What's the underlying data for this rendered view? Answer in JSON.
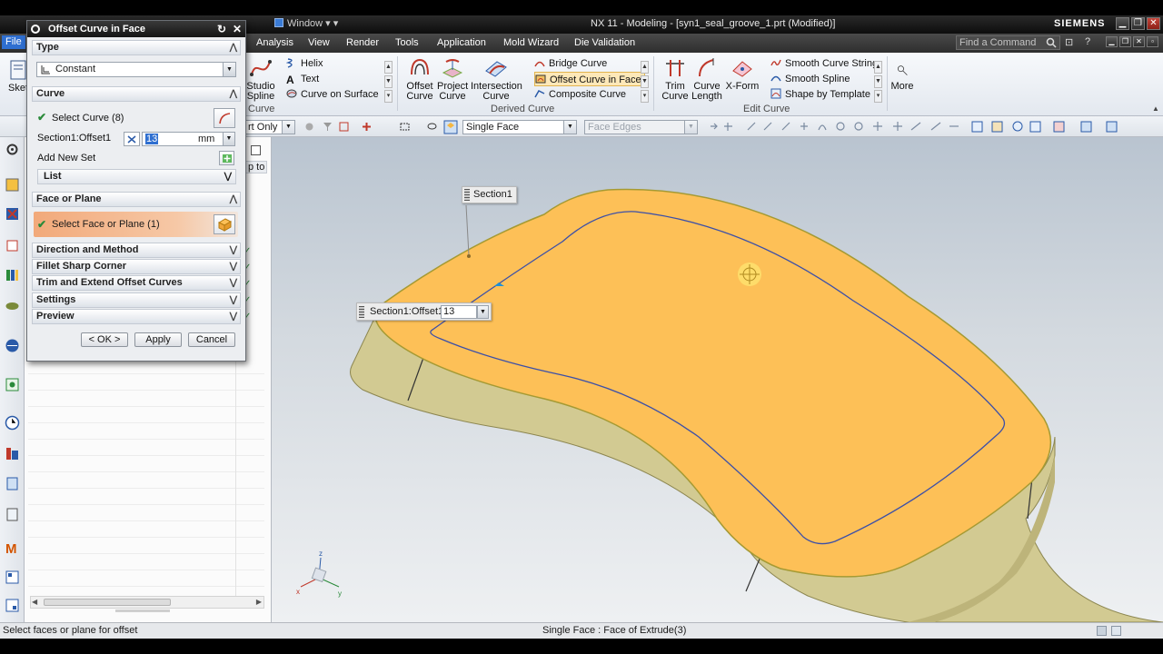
{
  "window": {
    "title": "NX 11 - Modeling - [syn1_seal_groove_1.prt (Modified)]",
    "brand": "SIEMENS",
    "window_menu": "Window"
  },
  "menubar": {
    "file_partial": "File",
    "items": [
      "Analysis",
      "View",
      "Render",
      "Tools",
      "Application",
      "Mold Wizard",
      "Die Validation"
    ],
    "search_placeholder": "Find a Command"
  },
  "ribbon": {
    "sketch_partial": "Sket",
    "studio_spline": [
      "Studio",
      "Spline"
    ],
    "curve_group_label": "Curve",
    "small_curve_items": [
      "Helix",
      "Text",
      "Curve on Surface"
    ],
    "offset_curve": [
      "Offset",
      "Curve"
    ],
    "project_curve": [
      "Project",
      "Curve"
    ],
    "intersection_curve": [
      "Intersection",
      "Curve"
    ],
    "derived_items": [
      "Bridge Curve",
      "Offset Curve in Face",
      "Composite Curve"
    ],
    "derived_group_label": "Derived Curve",
    "trim_curve": [
      "Trim",
      "Curve"
    ],
    "curve_length": [
      "Curve",
      "Length"
    ],
    "xform": "X-Form",
    "edit_items": [
      "Smooth Curve String",
      "Smooth Spline",
      "Shape by Template"
    ],
    "edit_group_label": "Edit Curve",
    "more": "More"
  },
  "selection_bar": {
    "filter_partial": "rt Only",
    "face_rule": "Single Face",
    "edge_rule": "Face Edges"
  },
  "navigator": {
    "snippet": "p to"
  },
  "dialog": {
    "title": "Offset Curve in Face",
    "type_section": "Type",
    "type_value": "Constant",
    "curve_section": "Curve",
    "select_curve": "Select Curve (8)",
    "offset_label": "Section1:Offset1",
    "offset_value": "13",
    "offset_unit": "mm",
    "add_new_set": "Add New Set",
    "list": "List",
    "face_section": "Face or Plane",
    "select_face": "Select Face or Plane (1)",
    "collapsed_sections": [
      "Direction and Method",
      "Fillet Sharp Corner",
      "Trim and Extend Offset Curves",
      "Settings",
      "Preview"
    ],
    "ok": "< OK >",
    "apply": "Apply",
    "cancel": "Cancel"
  },
  "viewport": {
    "section_tag": "Section1",
    "offset_tag": "Section1:Offset1",
    "offset_tag_value": "13"
  },
  "status": {
    "left": "Select faces or plane for offset",
    "center": "Single Face : Face of Extrude(3)"
  },
  "colors": {
    "face_orange": "#fdc057",
    "side_khaki": "#d2ca92",
    "curve_blue": "#3b4fa8",
    "selected_row": "#f2a97a"
  }
}
